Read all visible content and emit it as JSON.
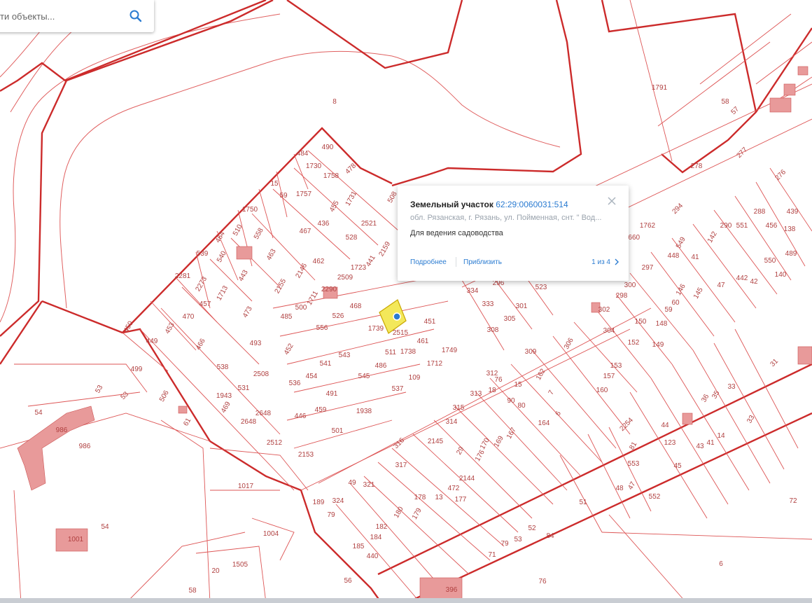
{
  "search": {
    "placeholder": "ти объекты..."
  },
  "icons": {
    "search": "search-icon",
    "close": "close-icon",
    "next": "chevron-right-icon",
    "marker": "location-dot-icon"
  },
  "colors": {
    "boundary": "#cc3333",
    "parcel_fill": "#e99a9a",
    "selected_fill": "#f3e85a",
    "link": "#2a7bd1",
    "marker": "#2a7bd1"
  },
  "popup": {
    "title": "Земельный участок",
    "cadastral_number": "62:29:0060031:514",
    "address": "обл. Рязанская, г. Рязань, ул. Пойменная, снт. \" Вод...",
    "purpose": "Для ведения садоводства",
    "details_link": "Подробнее",
    "zoom_link": "Приблизить",
    "pager": "1 из 4"
  },
  "map_labels": [
    "8",
    "1791",
    "58",
    "57",
    "278",
    "277",
    "276",
    "439",
    "138",
    "456",
    "288",
    "551",
    "489",
    "550",
    "142",
    "290",
    "140",
    "1762",
    "2660",
    "294",
    "549",
    "448",
    "41",
    "47",
    "442",
    "42",
    "297",
    "300",
    "298",
    "59",
    "148",
    "146",
    "145",
    "60",
    "150",
    "149",
    "152",
    "153",
    "157",
    "160",
    "302",
    "304",
    "31",
    "33",
    "36",
    "35",
    "33",
    "14",
    "41",
    "43",
    "44",
    "123",
    "45",
    "552",
    "47",
    "48",
    "81",
    "553",
    "51",
    "72",
    "6",
    "76",
    "396",
    "84",
    "52",
    "53",
    "79",
    "71",
    "2254",
    "306",
    "162",
    "7",
    "6",
    "164",
    "15",
    "80",
    "90",
    "18",
    "313",
    "76",
    "312",
    "309",
    "315",
    "314",
    "2145",
    "29",
    "170",
    "169",
    "167",
    "176",
    "2144",
    "472",
    "177",
    "13",
    "178",
    "179",
    "180",
    "182",
    "184",
    "185",
    "440",
    "49",
    "324",
    "79",
    "189",
    "321",
    "316",
    "317",
    "334",
    "296",
    "523",
    "301",
    "333",
    "305",
    "308",
    "451",
    "1749",
    "461",
    "1712",
    "2515",
    "1738",
    "511",
    "109",
    "537",
    "486",
    "545",
    "543",
    "541",
    "454",
    "491",
    "459",
    "501",
    "1938",
    "446",
    "536",
    "452",
    "485",
    "500",
    "556",
    "526",
    "468",
    "1739",
    "1711",
    "2290",
    "2509",
    "1723",
    "441",
    "2159",
    "528",
    "2521",
    "1731",
    "455",
    "436",
    "467",
    "462",
    "2146",
    "2155",
    "463",
    "558",
    "1750",
    "510",
    "464",
    "539",
    "540",
    "443",
    "2273",
    "2281",
    "1713",
    "457",
    "470",
    "453",
    "449",
    "450",
    "473",
    "493",
    "466",
    "538",
    "531",
    "2508",
    "1943",
    "469",
    "2648",
    "2648",
    "2512",
    "2153",
    "499",
    "506",
    "61",
    "53",
    "53",
    "54",
    "986",
    "986",
    "1017",
    "54",
    "1001",
    "1004",
    "1505",
    "20",
    "58",
    "56",
    "15",
    "59",
    "1757",
    "1758",
    "1730",
    "484",
    "490",
    "478",
    "508",
    "497",
    "33"
  ]
}
